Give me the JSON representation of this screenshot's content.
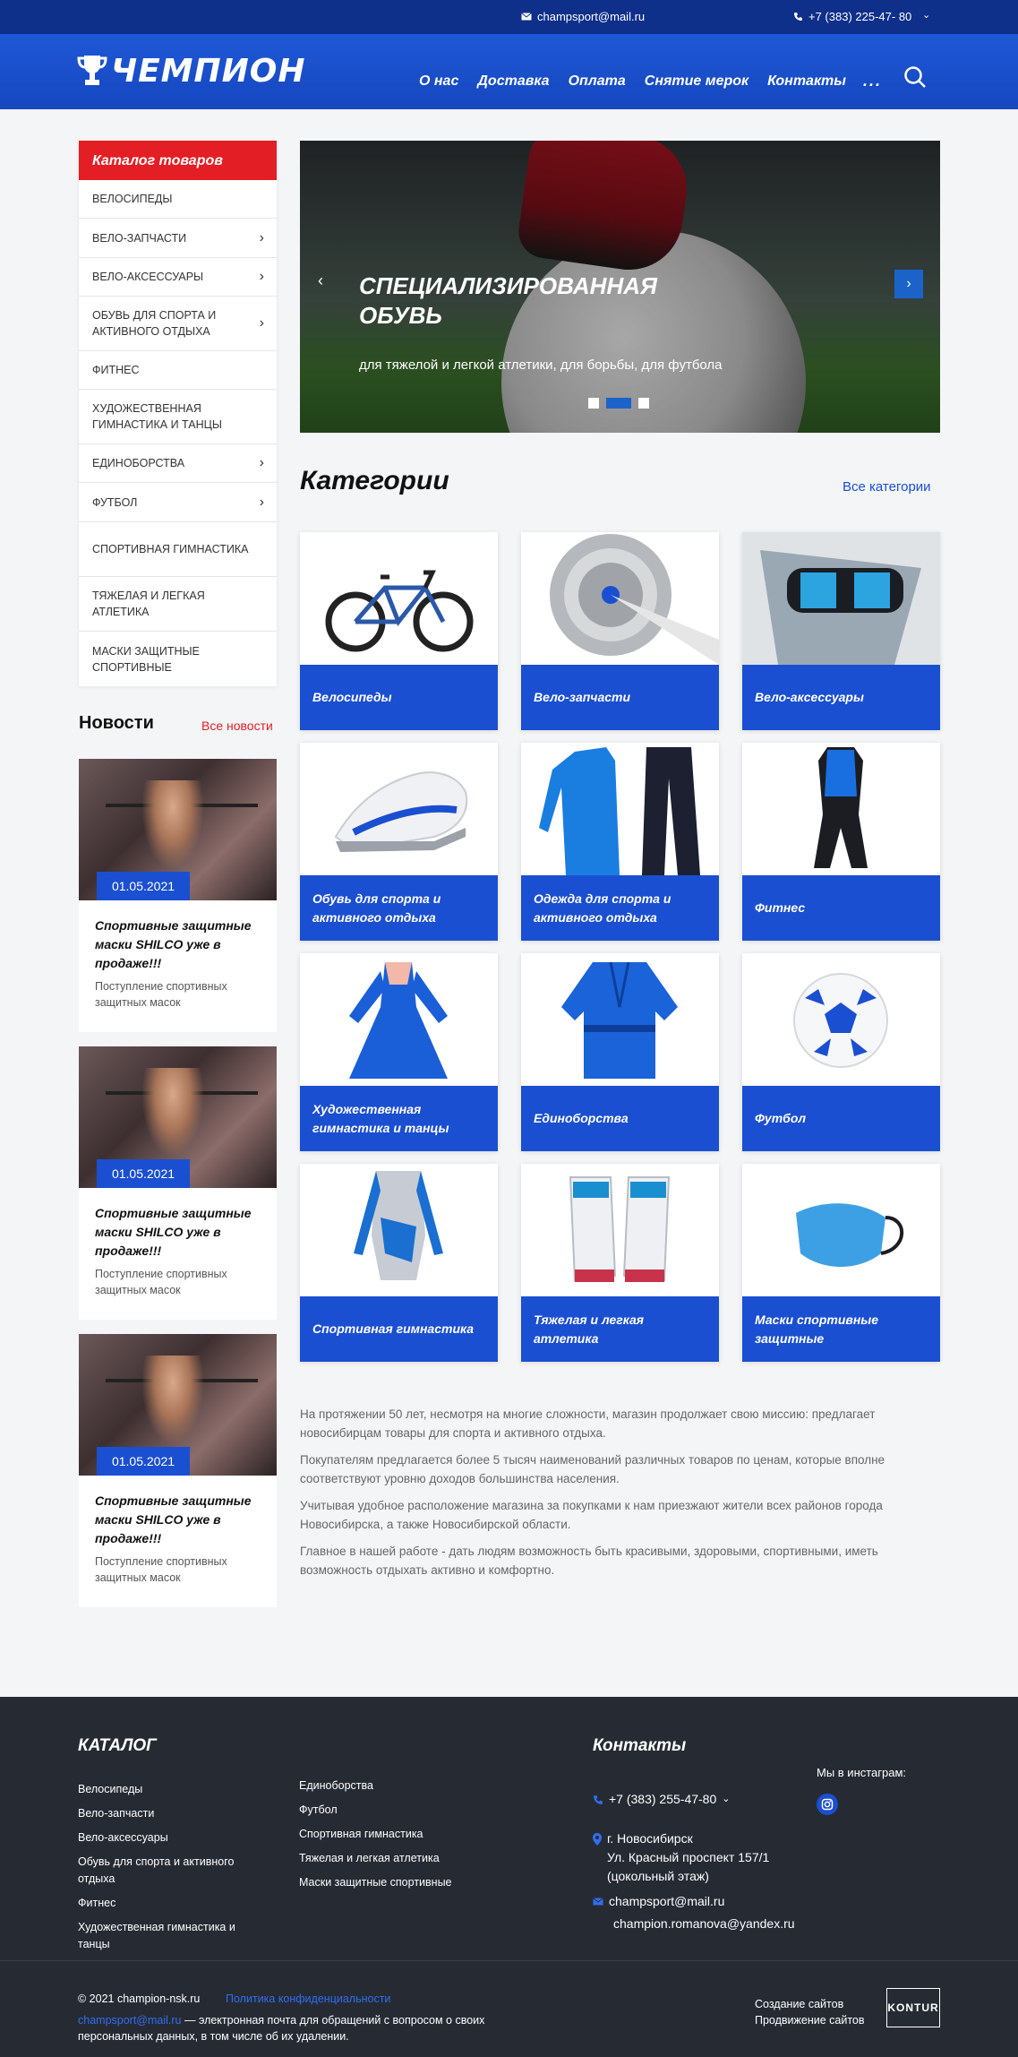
{
  "topbar": {
    "email": "champsport@mail.ru",
    "phone": "+7 (383) 225-47- 80"
  },
  "header": {
    "logo_text": "ЧЕМПИОН",
    "nav": [
      "О нас",
      "Доставка",
      "Оплата",
      "Снятие мерок",
      "Контакты"
    ],
    "more": "..."
  },
  "catalog": {
    "title": "Каталог товаров",
    "items": [
      {
        "label": "Велосипеды",
        "has_sub": false
      },
      {
        "label": "Вело-запчасти",
        "has_sub": true
      },
      {
        "label": "Вело-аксессуары",
        "has_sub": true
      },
      {
        "label": "Обувь для спорта и активного отдыха",
        "has_sub": true
      },
      {
        "label": "Фитнес",
        "has_sub": false
      },
      {
        "label": "Художественная гимнастика и танцы",
        "has_sub": false
      },
      {
        "label": "Единоборства",
        "has_sub": true
      },
      {
        "label": "Футбол",
        "has_sub": true
      },
      {
        "label": "Спортивная гимнастика",
        "has_sub": false
      },
      {
        "label": "Тяжелая и легкая атлетика",
        "has_sub": false
      },
      {
        "label": "Маски защитные спортивные",
        "has_sub": false
      }
    ]
  },
  "news": {
    "title": "Новости",
    "all_label": "Все новости",
    "items": [
      {
        "date": "01.05.2021",
        "title": "Спортивные защитные маски SHILCO уже в продаже!!!",
        "text": "Поступление спортивных защитных масок"
      },
      {
        "date": "01.05.2021",
        "title": "Спортивные защитные маски SHILCO уже в продаже!!!",
        "text": "Поступление спортивных защитных масок"
      },
      {
        "date": "01.05.2021",
        "title": "Спортивные защитные маски SHILCO уже в продаже!!!",
        "text": "Поступление спортивных защитных масок"
      }
    ]
  },
  "slider": {
    "title": "СПЕЦИАЛИЗИРОВАННАЯ ОБУВЬ",
    "subtitle": "для тяжелой и легкой атлетики, для борьбы, для футбола",
    "slides_count": 3,
    "active_index": 1
  },
  "categories": {
    "title": "Категории",
    "all_label": "Все категории",
    "items": [
      {
        "label": "Велосипеды",
        "icon": "bicycle"
      },
      {
        "label": "Вело-запчасти",
        "icon": "bike-gears"
      },
      {
        "label": "Вело-аксессуары",
        "icon": "bike-bag"
      },
      {
        "label": "Обувь для спорта и активного отдыха",
        "icon": "sneaker"
      },
      {
        "label": "Одежда для спорта и активного отдыха",
        "icon": "tracksuit"
      },
      {
        "label": "Фитнес",
        "icon": "bodysuit"
      },
      {
        "label": "Художественная гимнастика и танцы",
        "icon": "dance-dress"
      },
      {
        "label": "Единоборства",
        "icon": "kimono"
      },
      {
        "label": "Футбол",
        "icon": "soccer-ball"
      },
      {
        "label": "Спортивная гимнастика",
        "icon": "leotard"
      },
      {
        "label": "Тяжелая и легкая атлетика",
        "icon": "lifting-shoes"
      },
      {
        "label": "Маски спортивные защитные",
        "icon": "face-mask"
      }
    ]
  },
  "about": [
    "На протяжении 50 лет, несмотря на многие сложности, магазин продолжает свою миссию: предлагает новосибирцам товары для спорта и активного отдыха.",
    "Покупателям предлагается более 5 тысяч наименований различных товаров по ценам, которые вполне соответствуют уровню доходов большинства населения.",
    "Учитывая удобное расположение магазина за покупками к нам приезжают жители всех районов города Новосибирска, а также Новосибирской области.",
    "Главное в нашей работе - дать людям возможность быть красивыми, здоровыми, спортивными, иметь возможность отдыхать активно и комфортно."
  ],
  "footer": {
    "catalog_title": "КАТАЛОГ",
    "col1": [
      "Велосипеды",
      "Вело-запчасти",
      "Вело-аксессуары",
      "Обувь для спорта и активного отдыха",
      "Фитнес",
      "Художественная гимнастика и танцы"
    ],
    "col2": [
      "Единоборства",
      "Футбол",
      "Спортивная гимнастика",
      "Тяжелая и легкая атлетика",
      "Маски защитные спортивные"
    ],
    "contacts_title": "Контакты",
    "phone": "+7 (383) 255-47-80",
    "address": "г. Новосибирск\nУл. Красный проспект 157/1\n(цокольный этаж)",
    "email1": "champsport@mail.ru",
    "email2": "champion.romanova@yandex.ru",
    "insta_label": "Мы в инстаграм:",
    "copyright": "© 2021 champion-nsk.ru",
    "privacy": "Политика конфиденциальности",
    "note_email": "champsport@mail.ru",
    "note_text": " — электронная почта для обращений с вопросом о своих персональных данных, в том числе об их удалении.",
    "dev1": "Создание сайтов",
    "dev2": "Продвижение сайтов",
    "kontur": "KONTUR"
  },
  "colors": {
    "brand_blue": "#1b4fd1",
    "accent_red": "#e31e24",
    "footer_bg": "#262a33"
  }
}
